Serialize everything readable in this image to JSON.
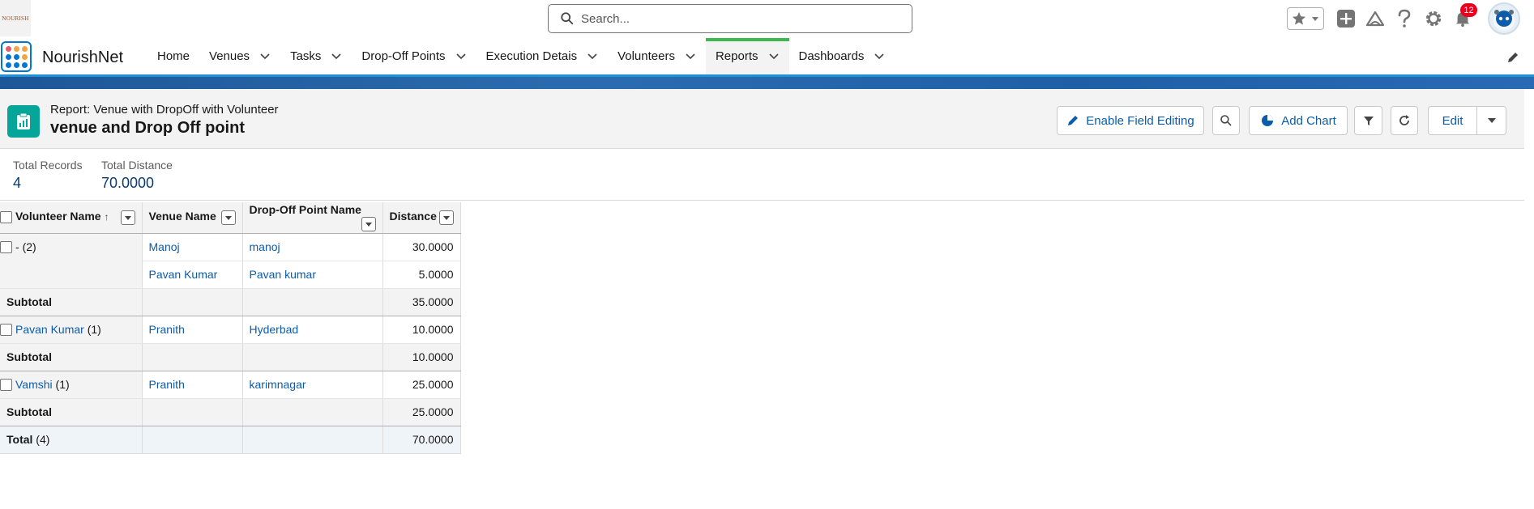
{
  "logo": {
    "text": "NOURISH"
  },
  "search": {
    "placeholder": "Search..."
  },
  "header": {
    "notifications": "12"
  },
  "app": {
    "name": "NourishNet"
  },
  "nav": {
    "tabs": [
      {
        "label": "Home"
      },
      {
        "label": "Venues"
      },
      {
        "label": "Tasks"
      },
      {
        "label": "Drop-Off Points"
      },
      {
        "label": "Execution Detais"
      },
      {
        "label": "Volunteers"
      },
      {
        "label": "Reports"
      },
      {
        "label": "Dashboards"
      }
    ],
    "active": "Reports"
  },
  "report": {
    "type_label": "Report: Venue with DropOff with Volunteer",
    "title": "venue and Drop Off point",
    "buttons": {
      "enable_editing": "Enable Field Editing",
      "add_chart": "Add Chart",
      "edit": "Edit"
    }
  },
  "summary": {
    "records_label": "Total Records",
    "records_value": "4",
    "distance_label": "Total Distance",
    "distance_value": "70.0000"
  },
  "table": {
    "headers": [
      "Volunteer Name",
      "Venue Name",
      "Drop-Off Point Name",
      "Distance"
    ],
    "groups": [
      {
        "volunteer": "-",
        "count": "(2)",
        "rows": [
          {
            "venue": "Manoj",
            "dropoff": "manoj",
            "distance": "30.0000"
          },
          {
            "venue": "Pavan Kumar",
            "dropoff": "Pavan kumar",
            "distance": "5.0000"
          }
        ],
        "subtotal": "35.0000"
      },
      {
        "volunteer": "Pavan Kumar",
        "count": "(1)",
        "rows": [
          {
            "venue": "Pranith",
            "dropoff": "Hyderbad",
            "distance": "10.0000"
          }
        ],
        "subtotal": "10.0000"
      },
      {
        "volunteer": "Vamshi",
        "count": "(1)",
        "rows": [
          {
            "venue": "Pranith",
            "dropoff": "karimnagar",
            "distance": "25.0000"
          }
        ],
        "subtotal": "25.0000"
      }
    ],
    "subtotal_label": "Subtotal",
    "total_label": "Total",
    "total_count": "(4)",
    "total_value": "70.0000"
  },
  "colors": {
    "accent": "#0176d3",
    "link": "#0b5cab",
    "active_tab": "#3cb94b",
    "report_icon": "#06a59a"
  }
}
